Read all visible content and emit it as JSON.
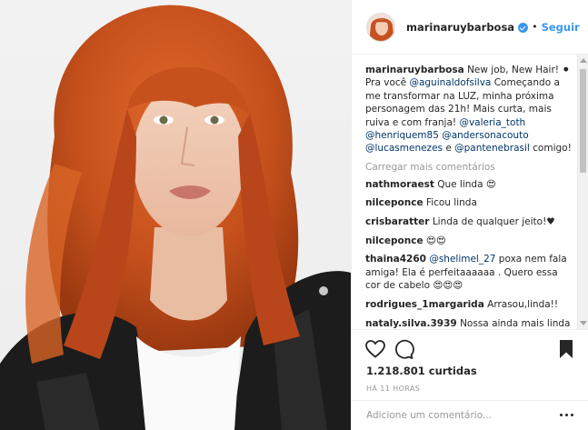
{
  "post": {
    "image_alt": "",
    "colors": {
      "hair": "#c8501f",
      "jacket": "#1c1c1c",
      "background": "#efefef",
      "link": "#003569",
      "follow": "#3897f0"
    }
  },
  "header": {
    "username": "marinaruybarbosa",
    "verified_icon": "verified-badge-icon",
    "separator": "•",
    "follow_label": "Seguir"
  },
  "caption": {
    "username": "marinaruybarbosa",
    "text1": "New job, New Hair! ⚫ Pra você",
    "mention1": "@aguinaldofsilva",
    "text2": "Começando a me transformar na LUZ, minha próxima personagem das 21h! Mais curta, mais ruiva e com franja!",
    "mention2": "@valeria_toth",
    "mention3": "@henriquem85",
    "mention4": "@andersonacouto",
    "mention5": "@lucasmenezes",
    "text3": " e ",
    "mention6": "@pantenebrasil",
    "text4": " comigo!"
  },
  "load_more": "Carregar mais comentários",
  "comments": [
    {
      "user": "nathmoraest",
      "text": "Que linda 😍"
    },
    {
      "user": "nilceponce",
      "text": "Ficou linda"
    },
    {
      "user": "crisbaratter",
      "text": "Linda de qualquer jeito!♥"
    },
    {
      "user": "nilceponce",
      "text": "😍😍"
    },
    {
      "user": "thaina4260",
      "mention": "@shelimel_27",
      "text": "poxa nem fala amiga! Ela é perfeitaaaaaa . Quero essa cor de cabelo 😍😍😍"
    },
    {
      "user": "rodrigues_1margarida",
      "text": "Arrasou,linda!!"
    },
    {
      "user": "nataly.silva.3939",
      "text": "Nossa ainda mais linda😍"
    }
  ],
  "actions": {
    "like_icon": "heart-icon",
    "comment_icon": "comment-icon",
    "save_icon": "bookmark-icon",
    "likes": "1.218.801 curtidas",
    "timestamp": "HÁ 11 HORAS"
  },
  "add_comment": {
    "placeholder": "Adicione um comentário...",
    "more_icon": "more-options-icon"
  }
}
